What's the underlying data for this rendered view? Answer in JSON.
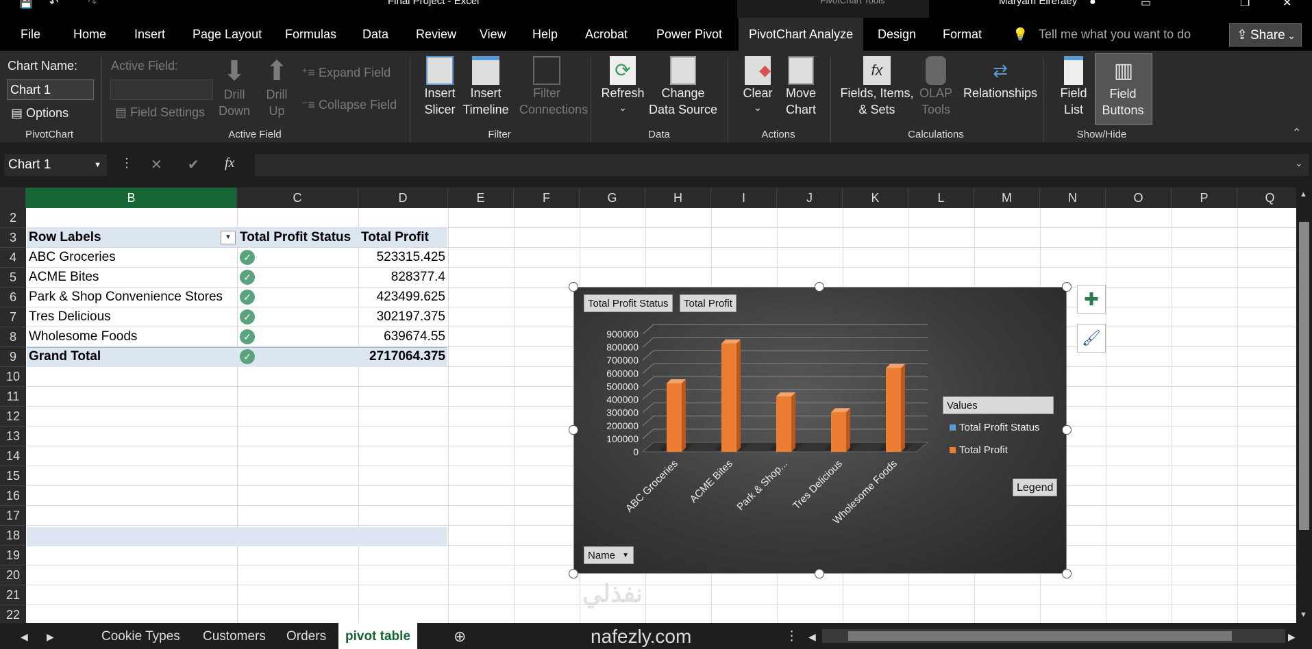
{
  "titlebar": {
    "doc_title": "Final Project  -  Excel",
    "context_title": "PivotChart Tools",
    "user": "Maryam Elreraey"
  },
  "menu": {
    "tabs": [
      "File",
      "Home",
      "Insert",
      "Page Layout",
      "Formulas",
      "Data",
      "Review",
      "View",
      "Help",
      "Acrobat",
      "Power Pivot",
      "PivotChart Analyze",
      "Design",
      "Format"
    ],
    "active": "PivotChart Analyze",
    "tell_me": "Tell me what you want to do",
    "share": "Share"
  },
  "ribbon": {
    "pivotchart": {
      "chart_name_label": "Chart Name:",
      "chart_name_value": "Chart 1",
      "options": "Options",
      "group": "PivotChart"
    },
    "active_field": {
      "label": "Active Field:",
      "field_settings": "Field Settings",
      "drill_down": "Drill Down",
      "drill_up": "Drill Up",
      "expand": "Expand Field",
      "collapse": "Collapse Field",
      "group": "Active Field"
    },
    "filter": {
      "slicer": "Insert Slicer",
      "timeline": "Insert Timeline",
      "connections": "Filter Connections",
      "group": "Filter"
    },
    "data": {
      "refresh": "Refresh",
      "change_source": "Change Data Source",
      "group": "Data"
    },
    "actions": {
      "clear": "Clear",
      "move": "Move Chart",
      "group": "Actions"
    },
    "calculations": {
      "fields": "Fields, Items, & Sets",
      "olap": "OLAP Tools",
      "relationships": "Relationships",
      "group": "Calculations"
    },
    "showhide": {
      "field_list": "Field List",
      "field_buttons": "Field Buttons",
      "group": "Show/Hide"
    }
  },
  "formula_bar": {
    "name_box": "Chart 1",
    "fx": "fx",
    "value": ""
  },
  "columns": [
    "B",
    "C",
    "D",
    "E",
    "F",
    "G",
    "H",
    "I",
    "J",
    "K",
    "L",
    "M",
    "N",
    "O",
    "P",
    "Q"
  ],
  "rows": [
    "2",
    "3",
    "4",
    "5",
    "6",
    "7",
    "8",
    "9",
    "10",
    "11",
    "12",
    "13",
    "14",
    "15",
    "16",
    "17",
    "18",
    "19",
    "20",
    "21",
    "22"
  ],
  "pivot": {
    "headers": [
      "Row Labels",
      "Total Profit Status",
      "Total Profit"
    ],
    "rows": [
      {
        "label": "ABC Groceries",
        "value": "523315.425"
      },
      {
        "label": "ACME Bites",
        "value": "828377.4"
      },
      {
        "label": "Park & Shop Convenience Stores",
        "value": "423499.625"
      },
      {
        "label": "Tres Delicious",
        "value": "302197.375"
      },
      {
        "label": "Wholesome Foods",
        "value": "639674.55"
      }
    ],
    "total": {
      "label": "Grand Total",
      "value": "2717064.375"
    }
  },
  "chart_data": {
    "type": "bar",
    "categories": [
      "ABC Groceries",
      "ACME Bites",
      "Park & Shop...",
      "Tres Delicious",
      "Wholesome Foods"
    ],
    "series": [
      {
        "name": "Total Profit Status",
        "values": [
          0,
          0,
          0,
          0,
          0
        ],
        "color": "#5b9bd5"
      },
      {
        "name": "Total Profit",
        "values": [
          523315.425,
          828377.4,
          423499.625,
          302197.375,
          639674.55
        ],
        "color": "#ed7d31"
      }
    ],
    "ylim": [
      0,
      900000
    ],
    "yticks": [
      "0",
      "100000",
      "200000",
      "300000",
      "400000",
      "500000",
      "600000",
      "700000",
      "800000",
      "900000"
    ],
    "title": "",
    "xlabel": "",
    "ylabel": "",
    "field_buttons": [
      "Total Profit Status",
      "Total Profit"
    ],
    "axis_button": "Name",
    "legend_title": "Values",
    "legend_button": "Legend",
    "legend_position": "right"
  },
  "sheets": {
    "tabs": [
      "Cookie Types",
      "Customers",
      "Orders",
      "pivot table"
    ],
    "active": "pivot table"
  },
  "watermark": "nafezly.com"
}
